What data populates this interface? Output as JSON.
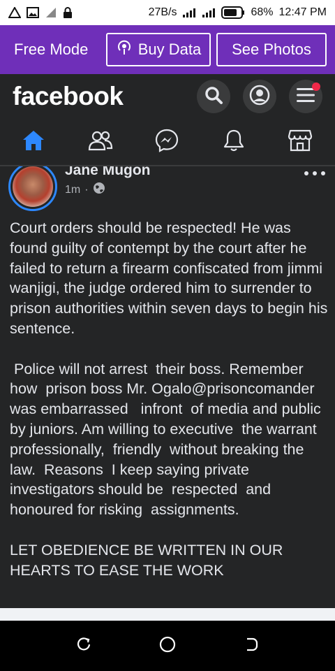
{
  "status_bar": {
    "speed": "27B/s",
    "battery_pct": "68%",
    "time": "12:47 PM"
  },
  "free_mode": {
    "label": "Free Mode",
    "buy_data": "Buy Data",
    "see_photos": "See Photos"
  },
  "header": {
    "logo": "facebook"
  },
  "post": {
    "author": "Jane Mugon",
    "time": "1m",
    "separator": "·",
    "body": "Court orders should be respected! He was found guilty of contempt by the court after he failed to return a firearm confiscated from jimmi wanjigi, the judge ordered him to surrender to prison authorities within seven days to begin his sentence.\n\n Police will not arrest  their boss. Remember  how  prison boss Mr. Ogalo@prisoncomander was embarrassed   infront  of media and public by juniors. Am willing to executive  the warrant professionally,  friendly  without breaking the law.  Reasons  I keep saying private investigators should be  respected  and honoured for risking  assignments.\n\nLET OBEDIENCE BE WRITTEN IN OUR HEARTS TO EASE THE WORK"
  },
  "colors": {
    "accent": "#2d88ff",
    "free_bar": "#6f2fb9",
    "background": "#242526",
    "notification": "#f02849"
  }
}
